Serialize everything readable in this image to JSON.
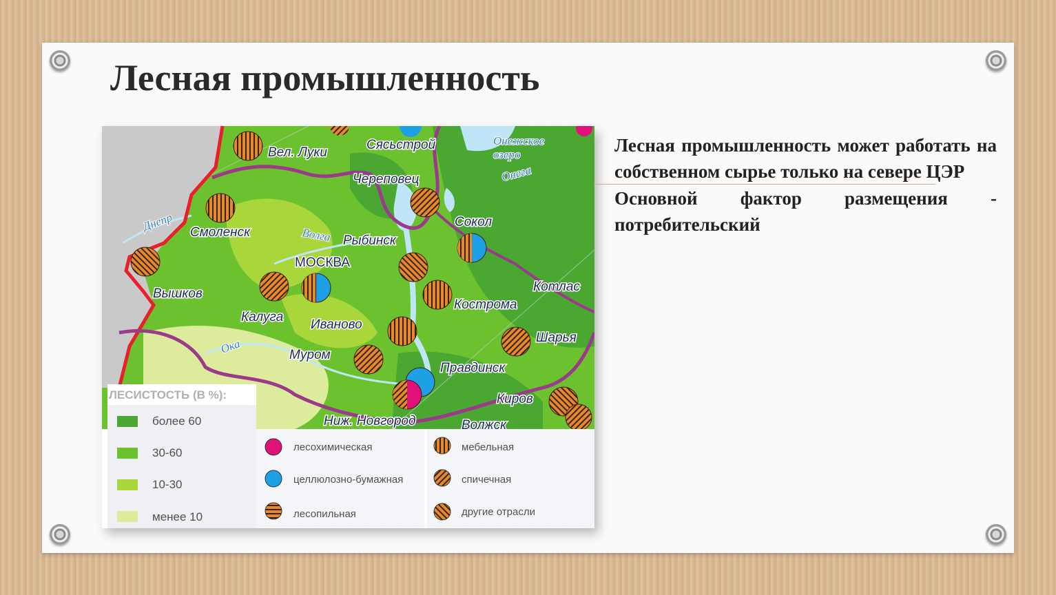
{
  "title": "Лесная промышленность",
  "paragraphs": [
    "Лесная промышленность может работать на собственном сырье только на севере ЦЭР",
    "Основной фактор размещения - потребительский"
  ],
  "map": {
    "cities": [
      {
        "name": "Вел. Луки"
      },
      {
        "name": "Сясьстрой"
      },
      {
        "name": "Череповец"
      },
      {
        "name": "Смоленск"
      },
      {
        "name": "Рыбинск"
      },
      {
        "name": "Сокол"
      },
      {
        "name": "МОСКВА"
      },
      {
        "name": "Вышков"
      },
      {
        "name": "Котлас"
      },
      {
        "name": "Кострома"
      },
      {
        "name": "Калуга"
      },
      {
        "name": "Иваново"
      },
      {
        "name": "Шарья"
      },
      {
        "name": "Муром"
      },
      {
        "name": "Правдинск"
      },
      {
        "name": "Киров"
      },
      {
        "name": "Ниж. Новгород"
      },
      {
        "name": "Волжск"
      }
    ],
    "water_labels": [
      "Днепр",
      "Волга",
      "Ока",
      "Онежское",
      "озеро",
      "Онега"
    ],
    "forest_legend": {
      "title": "ЛЕСИСТОСТЬ (В %):",
      "items": [
        {
          "label": "более 60",
          "color": "#4aa832"
        },
        {
          "label": "30-60",
          "color": "#6cc22e"
        },
        {
          "label": "10-30",
          "color": "#a9d63a"
        },
        {
          "label": "менее 10",
          "color": "#dcec9c"
        }
      ]
    },
    "industry_legend": [
      {
        "label": "лесохимическая",
        "symbol": "pink"
      },
      {
        "label": "целлюлозно-бумажная",
        "symbol": "blue"
      },
      {
        "label": "лесопильная",
        "symbol": "hatch-horizontal"
      },
      {
        "label": "мебельная",
        "symbol": "hatch-vertical"
      },
      {
        "label": "спичечная",
        "symbol": "hatch-diagonal"
      },
      {
        "label": "другие отрасли",
        "symbol": "hatch-diagonal-2"
      }
    ]
  },
  "colors": {
    "orange": "#e58a2c",
    "pink": "#e0127a",
    "blue": "#1ea0e6",
    "border": "#9b3a8a",
    "outer_border": "#e8202a",
    "water": "#bfe6f6",
    "grey_land": "#c9c9c9"
  }
}
